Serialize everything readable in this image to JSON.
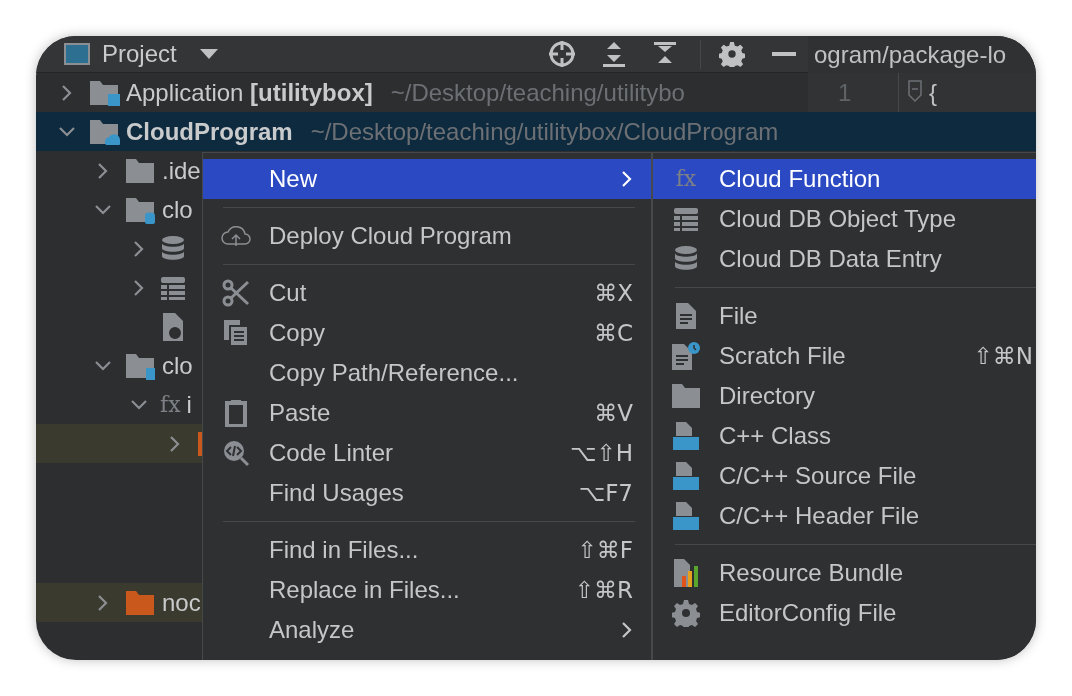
{
  "toolbar": {
    "title": "Project",
    "editor_tab": "ogram/package-lo"
  },
  "editor": {
    "line_number": "1",
    "code": "{"
  },
  "tree": [
    {
      "label": "Application **[utilitybox]**",
      "path": "~/Desktop/teaching/utilitybo",
      "kind": "module",
      "bold": false,
      "expanded": false,
      "selected": false,
      "excluded": false
    },
    {
      "label": "CloudProgram",
      "path": "~/Desktop/teaching/utilitybox/CloudProgram",
      "kind": "cloud",
      "bold": true,
      "expanded": true,
      "selected": true,
      "excluded": false,
      "children": [
        {
          "label": ".ide",
          "kind": "folder",
          "expanded": false,
          "selected": false,
          "excluded": false
        },
        {
          "label": "clo",
          "kind": "dbfolder",
          "expanded": true,
          "selected": false,
          "excluded": false,
          "children": [
            {
              "kind": "database",
              "expanded": false,
              "selected": false,
              "excluded": false
            },
            {
              "kind": "table",
              "expanded": false,
              "selected": false,
              "excluded": false
            },
            {
              "kind": "json",
              "selected": false,
              "excluded": false
            }
          ]
        },
        {
          "label": "clo",
          "kind": "fnfolder",
          "expanded": true,
          "selected": false,
          "excluded": false,
          "children": [
            {
              "label": "i",
              "kind": "function",
              "icon_text": "fx",
              "expanded": true,
              "selected": false,
              "excluded": false,
              "children": [
                {
                  "kind": "folder",
                  "expanded": false,
                  "selected": false,
                  "excluded": true
                }
              ]
            }
          ]
        },
        {
          "label": "noc",
          "kind": "folder",
          "expanded": false,
          "selected": false,
          "excluded": true
        }
      ]
    }
  ],
  "context_menu": [
    {
      "kind": "plain",
      "label": "New",
      "submenu": true,
      "selected": true
    },
    {
      "kind": "separator"
    },
    {
      "kind": "upload",
      "label": "Deploy Cloud Program",
      "selected": false
    },
    {
      "kind": "separator"
    },
    {
      "kind": "scissors",
      "label": "Cut",
      "shortcut": "⌘X",
      "selected": false
    },
    {
      "kind": "copy",
      "label": "Copy",
      "shortcut": "⌘C",
      "selected": false
    },
    {
      "kind": "plain",
      "label": "Copy Path/Reference...",
      "selected": false
    },
    {
      "kind": "paste",
      "label": "Paste",
      "shortcut": "⌘V",
      "selected": false
    },
    {
      "kind": "linter",
      "label": "Code Linter",
      "shortcut": "⌥⇧H",
      "selected": false
    },
    {
      "kind": "plain",
      "label": "Find Usages",
      "shortcut": "⌥F7",
      "selected": false
    },
    {
      "kind": "separator"
    },
    {
      "kind": "plain",
      "label": "Find in Files...",
      "shortcut": "⇧⌘F",
      "selected": false
    },
    {
      "kind": "plain",
      "label": "Replace in Files...",
      "shortcut": "⇧⌘R",
      "selected": false
    },
    {
      "kind": "plain",
      "label": "Analyze",
      "submenu": true,
      "selected": false
    }
  ],
  "new_submenu": [
    {
      "kind": "function",
      "label": "Cloud Function",
      "icon_text": "fx",
      "selected": true
    },
    {
      "kind": "table",
      "label": "Cloud DB Object Type",
      "selected": false
    },
    {
      "kind": "database",
      "label": "Cloud DB Data Entry",
      "selected": false
    },
    {
      "kind": "separator"
    },
    {
      "kind": "file",
      "label": "File",
      "selected": false
    },
    {
      "kind": "scratch",
      "label": "Scratch File",
      "shortcut": "⇧⌘N",
      "selected": false
    },
    {
      "kind": "folder",
      "label": "Directory",
      "selected": false
    },
    {
      "kind": "source",
      "label": "C++ Class",
      "selected": false
    },
    {
      "kind": "source",
      "label": "C/C++ Source File",
      "selected": false
    },
    {
      "kind": "source",
      "label": "C/C++ Header File",
      "selected": false
    },
    {
      "kind": "separator"
    },
    {
      "kind": "bundle",
      "label": "Resource Bundle",
      "selected": false
    },
    {
      "kind": "gear",
      "label": "EditorConfig File",
      "selected": false
    }
  ]
}
